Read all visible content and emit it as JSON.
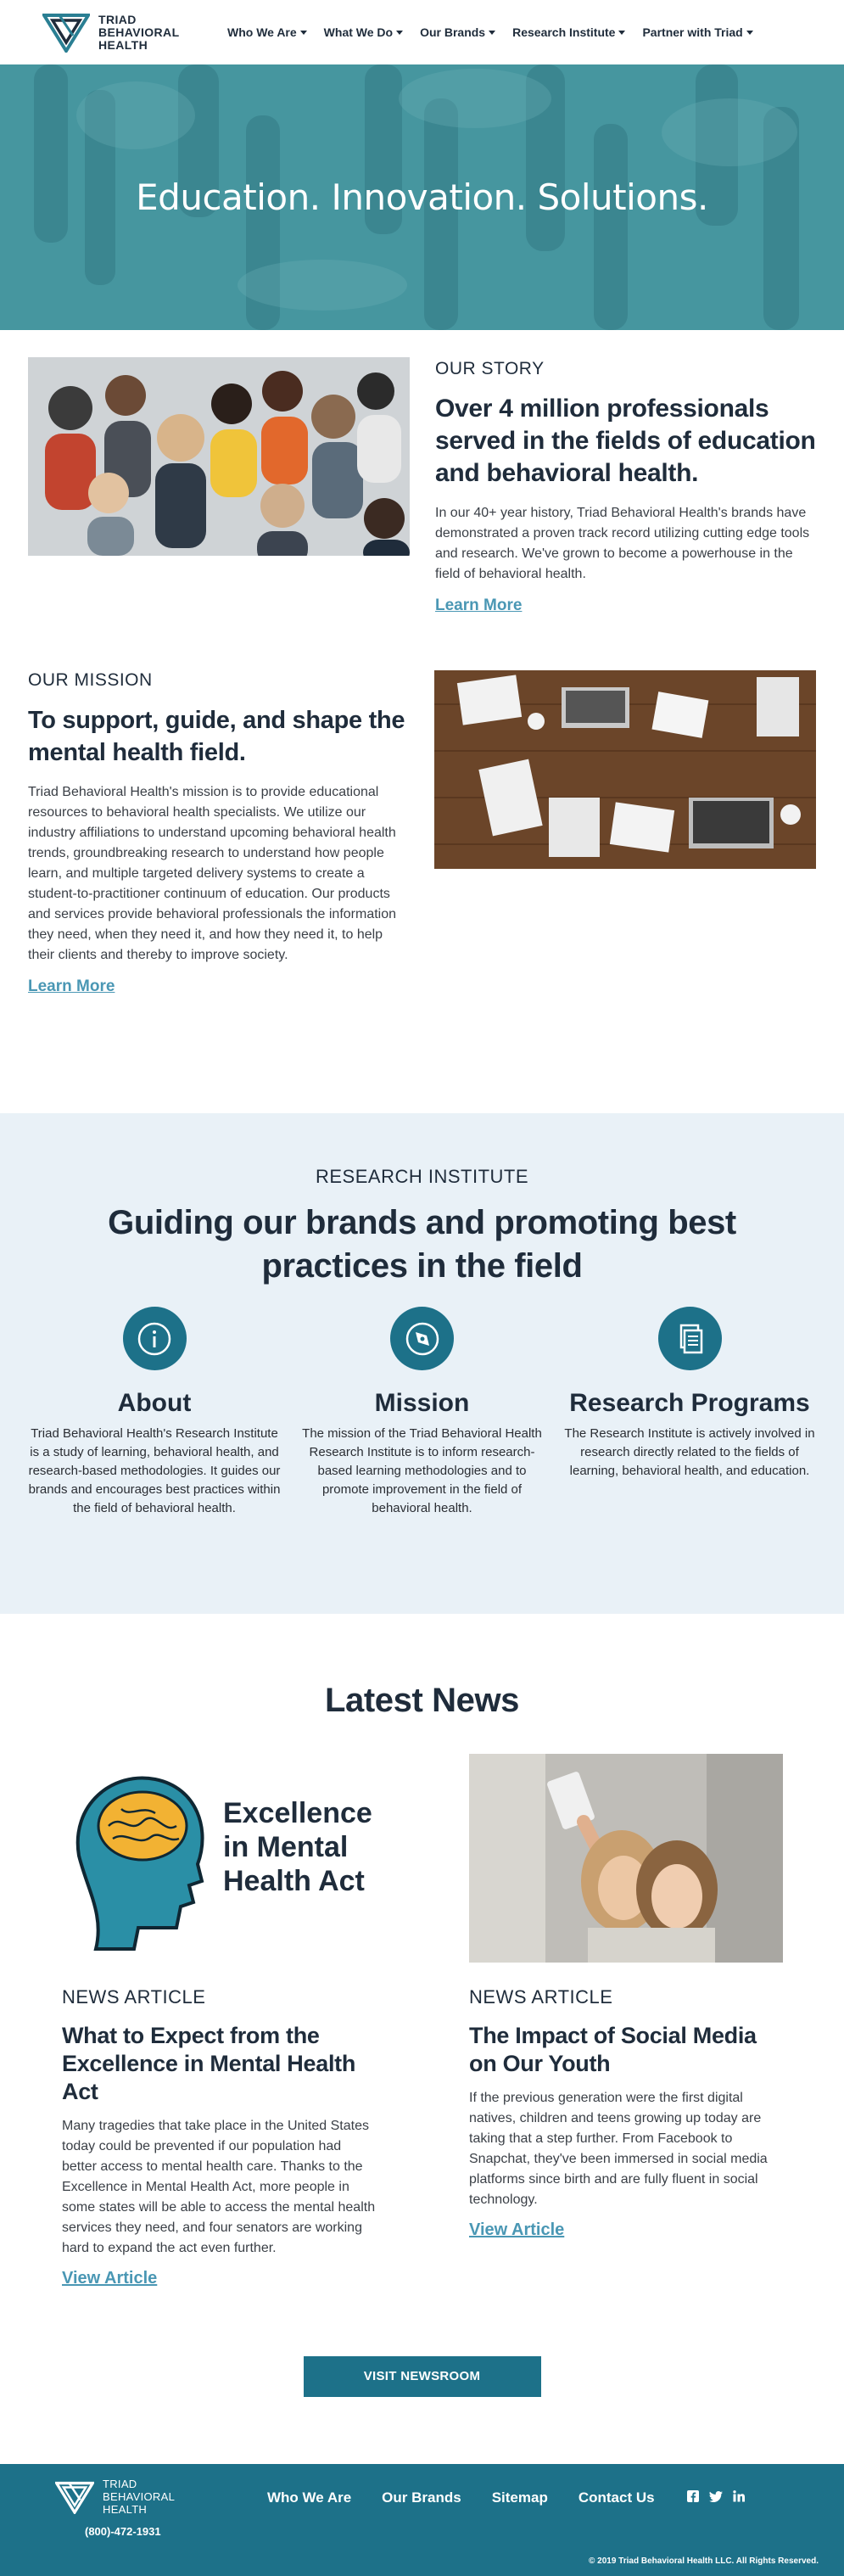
{
  "header": {
    "logo_lines": [
      "TRIAD",
      "BEHAVIORAL",
      "HEALTH"
    ],
    "nav": [
      "Who We Are",
      "What We Do",
      "Our Brands",
      "Research Institute",
      "Partner with Triad"
    ]
  },
  "hero": {
    "title": "Education. Innovation. Solutions."
  },
  "story": {
    "eyebrow": "OUR STORY",
    "title": "Over 4 million professionals served in the fields of education and behavioral health.",
    "text": "In our 40+ year history, Triad Behavioral Health's brands have demonstrated a proven track record utilizing cutting edge tools and research. We've grown to become a powerhouse in the field of behavioral health.",
    "link": "Learn More"
  },
  "mission": {
    "eyebrow": "OUR MISSION",
    "title": "To support, guide, and shape the mental health field.",
    "text": "Triad Behavioral Health's mission is to provide educational resources to behavioral health specialists. We utilize our industry affiliations to understand upcoming behavioral health trends, groundbreaking research to understand how people learn, and multiple targeted delivery systems to create a student-to-practitioner continuum of education. Our products and services provide behavioral professionals the information they need, when they need it, and how they need it, to help their clients and thereby to improve society.",
    "link": "Learn More"
  },
  "research": {
    "eyebrow": "RESEARCH INSTITUTE",
    "title": "Guiding our brands and promoting best practices in the field",
    "columns": [
      {
        "icon": "info-icon",
        "title": "About",
        "text": "Triad Behavioral Health's Research Institute is a study of learning, behavioral health, and research-based methodologies. It guides our brands and encourages best practices within the field of behavioral health."
      },
      {
        "icon": "compass-icon",
        "title": "Mission",
        "text": "The mission of the Triad Behavioral Health Research Institute is to inform research-based learning methodologies and to promote improvement in the field of behavioral health."
      },
      {
        "icon": "document-icon",
        "title": "Research Programs",
        "text": "The Research Institute is actively involved in research directly related to the fields of learning, behavioral health, and education."
      }
    ]
  },
  "news": {
    "heading": "Latest News",
    "articles": [
      {
        "image_caption_lines": [
          "Excellence",
          "in Mental",
          "Health Act"
        ],
        "eyebrow": "NEWS ARTICLE",
        "title": "What to Expect from the Excellence in Mental Health Act",
        "text": "Many tragedies that take place in the United States today could be prevented if our population had better access to mental health care. Thanks to the Excellence in Mental Health Act, more people in some states will be able to access the mental health services they need, and four senators are working hard to expand the act even further.",
        "link": "View Article"
      },
      {
        "eyebrow": "NEWS ARTICLE",
        "title": "The Impact of Social Media on Our Youth",
        "text": "If the previous generation were the first digital natives, children and teens growing up today are taking that a step further. From Facebook to Snapchat, they've been immersed in social media platforms since birth and are fully fluent in social technology.",
        "link": "View Article"
      }
    ],
    "button": "VISIT NEWSROOM"
  },
  "footer": {
    "logo_lines": [
      "TRIAD",
      "BEHAVIORAL",
      "HEALTH"
    ],
    "phone": "(800)-472-1931",
    "nav": [
      "Who We Are",
      "Our Brands",
      "Sitemap",
      "Contact Us"
    ],
    "social": [
      "facebook-icon",
      "twitter-icon",
      "linkedin-icon"
    ],
    "copyright": "© 2019 Triad Behavioral Health LLC. All Rights Reserved."
  },
  "colors": {
    "brand_teal": "#1d7189",
    "hero_teal": "#3f8f99",
    "link": "#4a97b4",
    "research_bg": "#e9f1f7",
    "text_dark": "#1f2c3b"
  }
}
